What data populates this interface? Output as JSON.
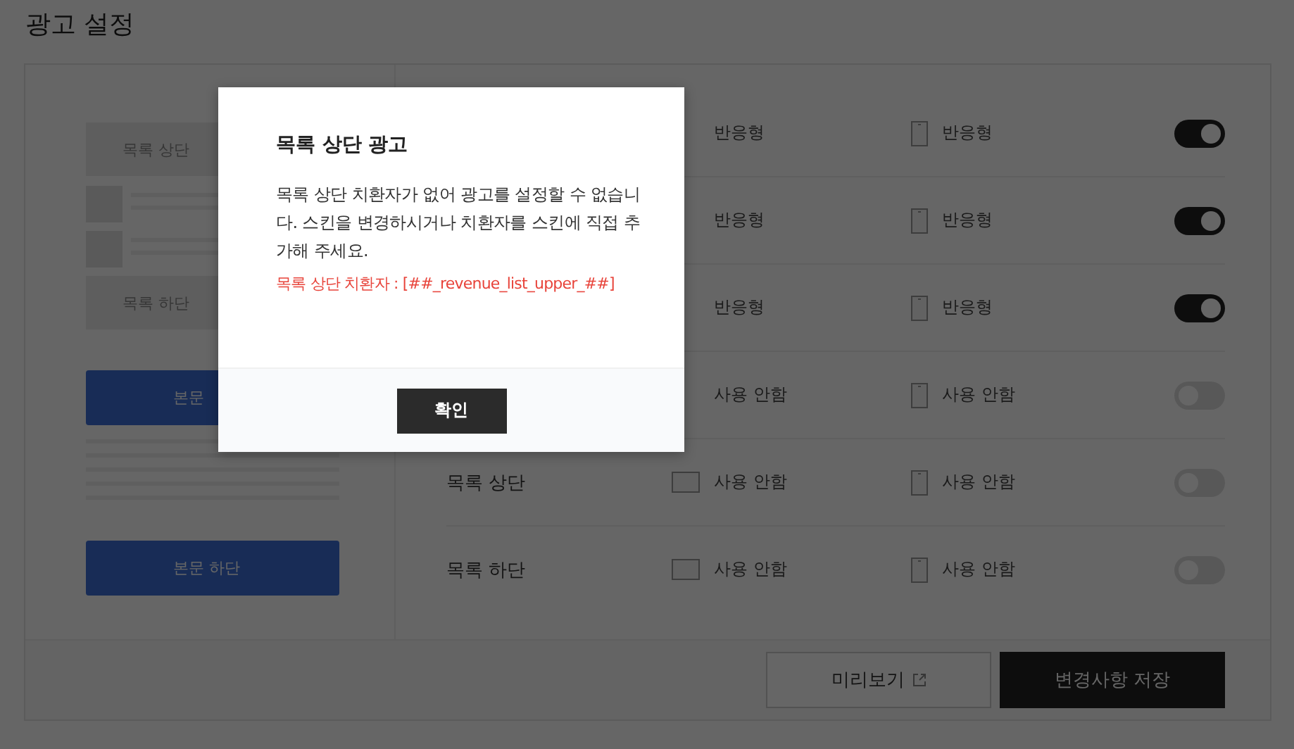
{
  "page": {
    "title": "광고 설정"
  },
  "preview": [
    {
      "kind": "slot",
      "label": "목록 상단"
    },
    {
      "kind": "list"
    },
    {
      "kind": "slot",
      "label": "목록 하단"
    },
    {
      "kind": "ad",
      "label": "본문"
    },
    {
      "kind": "lines"
    },
    {
      "kind": "ad",
      "label": "본문 하단"
    }
  ],
  "rows": [
    {
      "pc": "반응형",
      "mobile": "반응형",
      "on": true
    },
    {
      "pc": "반응형",
      "mobile": "반응형",
      "on": true
    },
    {
      "pc": "반응형",
      "mobile": "반응형",
      "on": true
    },
    {
      "pc": "사용 안함",
      "mobile": "사용 안함",
      "on": false
    },
    {
      "label": "목록 상단",
      "pc": "사용 안함",
      "mobile": "사용 안함",
      "on": false
    },
    {
      "label": "목록 하단",
      "pc": "사용 안함",
      "mobile": "사용 안함",
      "on": false
    }
  ],
  "footer": {
    "preview_button": "미리보기",
    "save_button": "변경사항 저장"
  },
  "dialog": {
    "title": "목록 상단 광고",
    "message": "목록 상단 치환자가 없어 광고를 설정할 수 없습니다. 스킨을 변경하시거나 치환자를 스킨에 직접 추가해 주세요.",
    "code": "목록 상단 치환자 : [##_revenue_list_upper_##]",
    "confirm": "확인"
  }
}
